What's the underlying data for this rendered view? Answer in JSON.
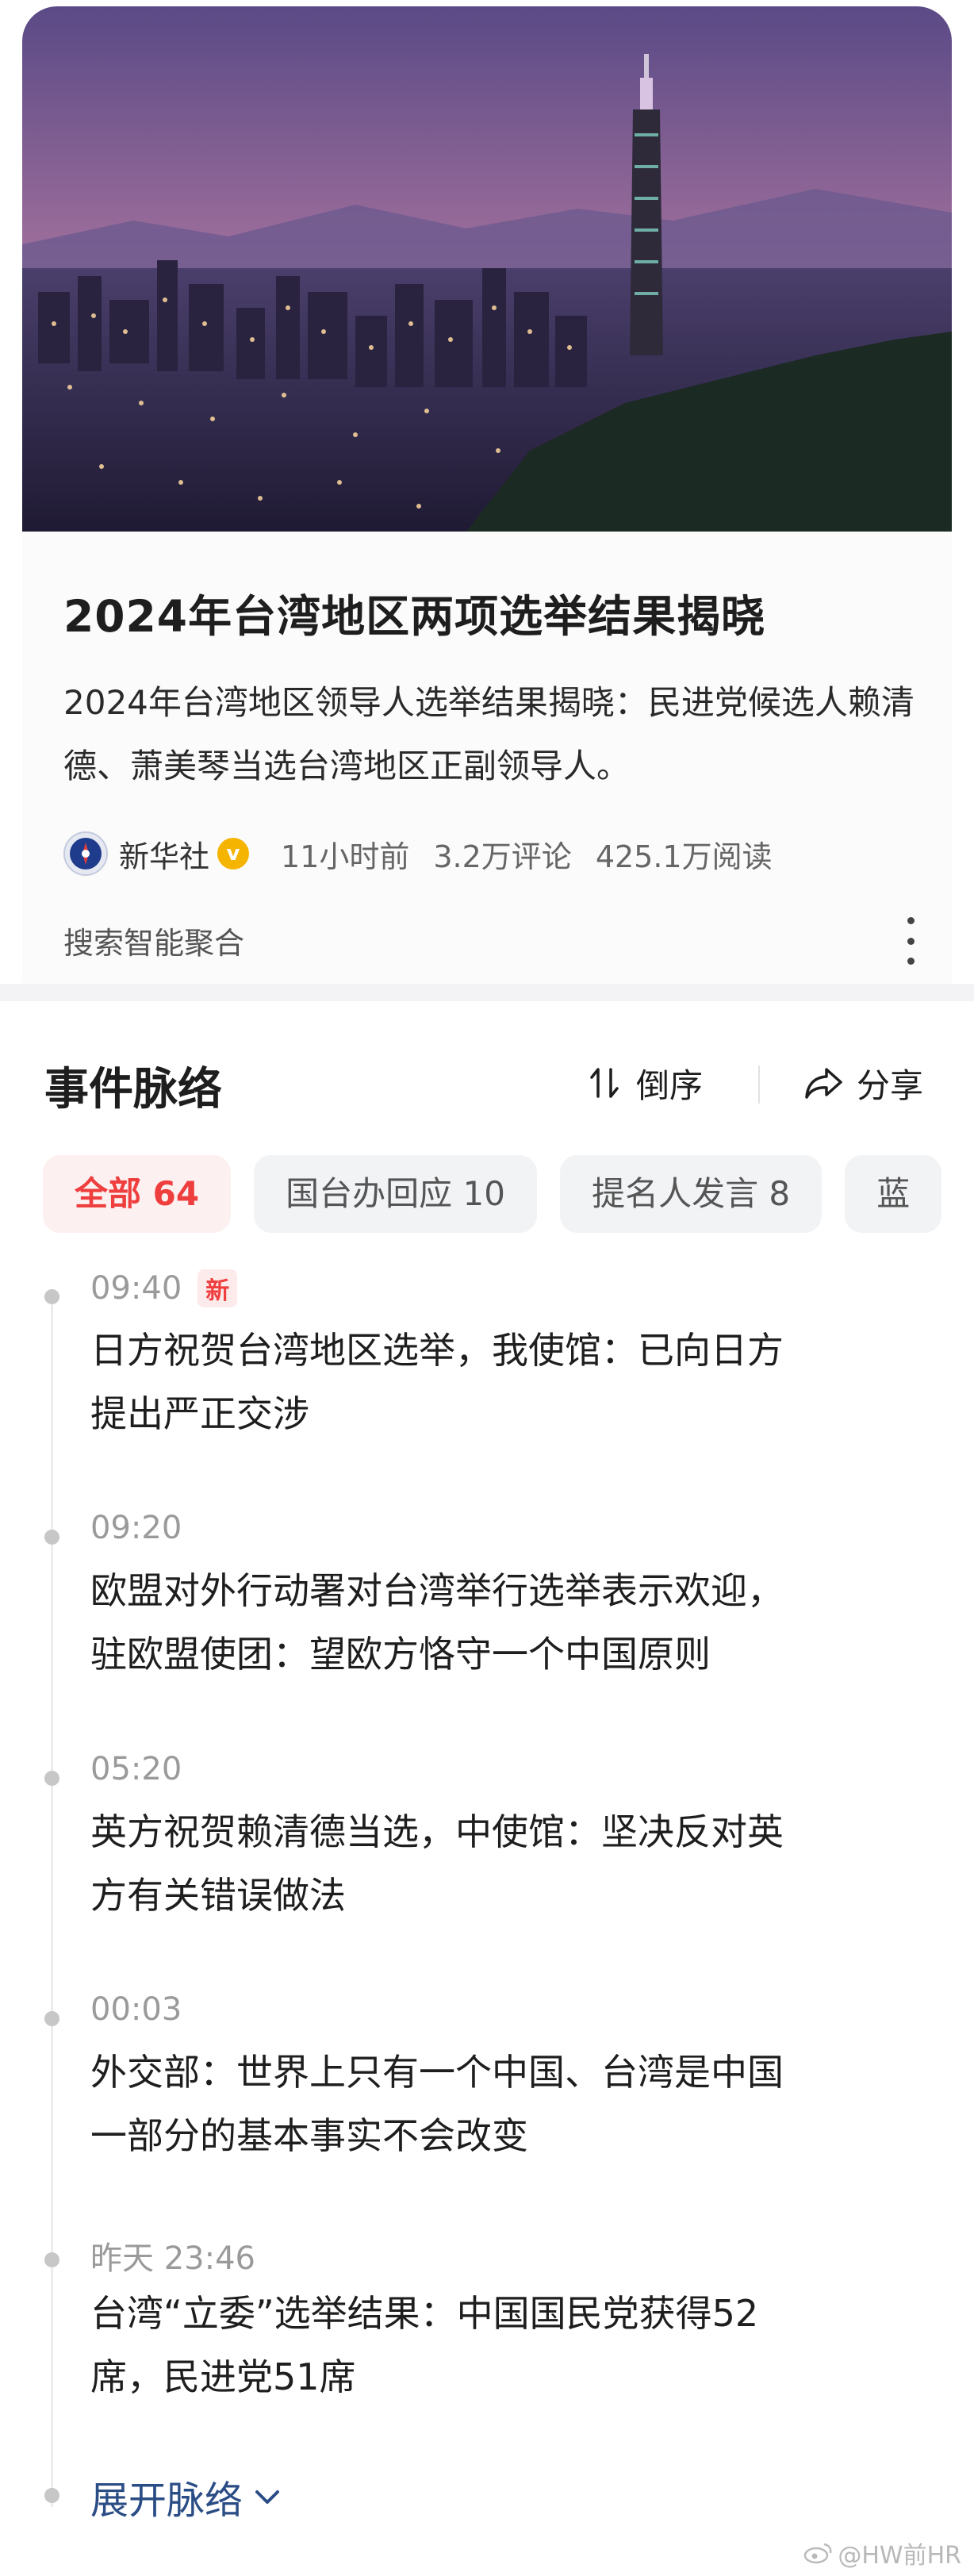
{
  "article": {
    "headline": "2024年台湾地区两项选举结果揭晓",
    "summary": "2024年台湾地区领导人选举结果揭晓：民进党候选人赖清德、萧美琴当选台湾地区正副领导人。",
    "source": "新华社",
    "time_ago": "11小时前",
    "comments": "3.2万评论",
    "reads": "425.1万阅读",
    "aggregate_label": "搜索智能聚合"
  },
  "timeline": {
    "title": "事件脉络",
    "sort_label": "倒序",
    "share_label": "分享",
    "chips": [
      {
        "label": "全部 64",
        "active": true
      },
      {
        "label": "国台办回应 10",
        "active": false
      },
      {
        "label": "提名人发言 8",
        "active": false
      },
      {
        "label": "蓝",
        "active": false
      }
    ],
    "items": [
      {
        "time": "09:40",
        "badge": "新",
        "text_line1": "日方祝贺台湾地区选举，我使馆：已向日方",
        "text_line2": "提出严正交涉"
      },
      {
        "time": "09:20",
        "badge": "",
        "text_line1": "欧盟对外行动署对台湾举行选举表示欢迎，",
        "text_line2": "驻欧盟使团：望欧方恪守一个中国原则"
      },
      {
        "time": "05:20",
        "badge": "",
        "text_line1": "英方祝贺赖清德当选，中使馆：坚决反对英",
        "text_line2": "方有关错误做法"
      },
      {
        "time": "00:03",
        "badge": "",
        "text_line1": "外交部：世界上只有一个中国、台湾是中国",
        "text_line2": "一部分的基本事实不会改变"
      },
      {
        "time": "昨天 23:46",
        "badge": "",
        "text_line1": "台湾“立委”选举结果：中国国民党获得52",
        "text_line2": "席，民进党51席"
      }
    ],
    "expand_label": "展开脉络"
  },
  "watermark": "@HW前HR",
  "colors": {
    "accent_red": "#ef3e3e",
    "link_blue": "#2b4d86",
    "verified_gold": "#f5b400"
  }
}
